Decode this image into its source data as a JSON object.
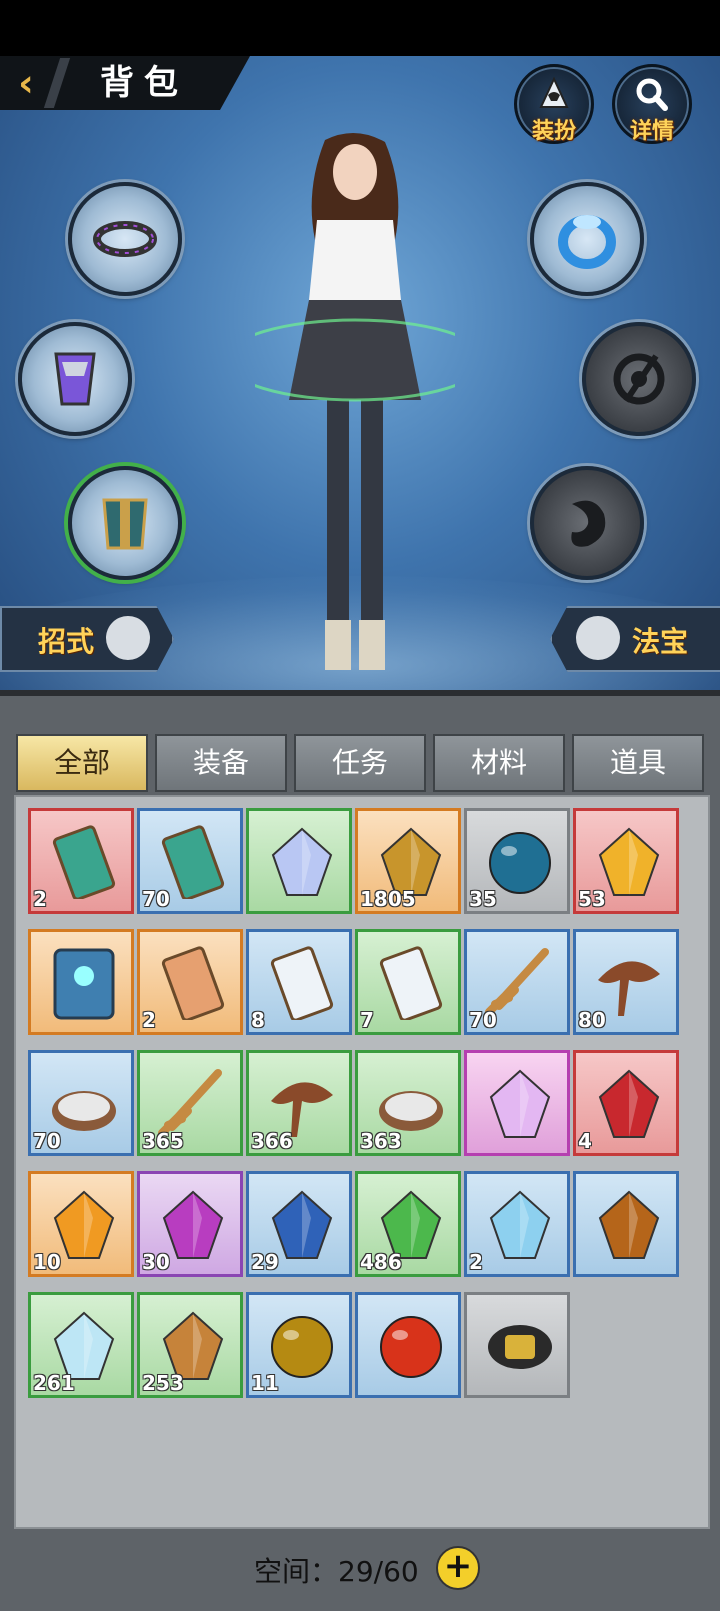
{
  "header": {
    "title": "背包",
    "back_icon": "‹"
  },
  "top_buttons": [
    {
      "label": "装扮",
      "icon": "hooded-figure-icon"
    },
    {
      "label": "详情",
      "icon": "magnifier-icon"
    }
  ],
  "side_buttons": {
    "left": "招式",
    "right": "法宝"
  },
  "tabs": [
    {
      "label": "全部",
      "active": true
    },
    {
      "label": "装备"
    },
    {
      "label": "任务"
    },
    {
      "label": "材料"
    },
    {
      "label": "道具"
    }
  ],
  "items": [
    {
      "quality": "red",
      "icon": "scroll-icon",
      "count": "2"
    },
    {
      "quality": "blue",
      "icon": "scroll-icon",
      "count": "70"
    },
    {
      "quality": "green",
      "icon": "crystal-icon",
      "count": ""
    },
    {
      "quality": "orange",
      "icon": "gold-egg-icon",
      "count": "1805"
    },
    {
      "quality": "grey",
      "icon": "blue-orb-icon",
      "count": "35"
    },
    {
      "quality": "red",
      "icon": "gold-drop-icon",
      "count": "53"
    },
    {
      "quality": "orange",
      "icon": "meditation-tablet-icon",
      "count": ""
    },
    {
      "quality": "orange",
      "icon": "talisman-icon",
      "count": "2"
    },
    {
      "quality": "blue",
      "icon": "paper-charm-icon",
      "count": "8"
    },
    {
      "quality": "green",
      "icon": "paper-charm-icon",
      "count": "7"
    },
    {
      "quality": "blue",
      "icon": "ginseng-icon",
      "count": "70"
    },
    {
      "quality": "blue",
      "icon": "lingzhi-icon",
      "count": "80"
    },
    {
      "quality": "blue",
      "icon": "rice-bowl-icon",
      "count": "70"
    },
    {
      "quality": "green",
      "icon": "ginseng-icon",
      "count": "365"
    },
    {
      "quality": "green",
      "icon": "lingzhi-icon",
      "count": "366"
    },
    {
      "quality": "green",
      "icon": "rice-bowl-icon",
      "count": "363"
    },
    {
      "quality": "pink",
      "icon": "rainbow-gem-icon",
      "count": ""
    },
    {
      "quality": "red",
      "icon": "red-ore-icon",
      "count": "4"
    },
    {
      "quality": "orange",
      "icon": "amber-gem-icon",
      "count": "10"
    },
    {
      "quality": "purple",
      "icon": "purple-gem-icon",
      "count": "30"
    },
    {
      "quality": "blue",
      "icon": "blue-gem-icon",
      "count": "29"
    },
    {
      "quality": "green",
      "icon": "green-shard-icon",
      "count": "486"
    },
    {
      "quality": "blue",
      "icon": "ice-stone-icon",
      "count": "2"
    },
    {
      "quality": "blue",
      "icon": "fire-stone-icon",
      "count": ""
    },
    {
      "quality": "green",
      "icon": "ice-crystal-icon",
      "count": "261"
    },
    {
      "quality": "green",
      "icon": "fire-egg-icon",
      "count": "253"
    },
    {
      "quality": "blue",
      "icon": "gold-orb-icon",
      "count": "11"
    },
    {
      "quality": "blue",
      "icon": "red-orb-icon",
      "count": ""
    },
    {
      "quality": "grey",
      "icon": "belt-icon",
      "count": ""
    }
  ],
  "footer": {
    "space_label": "空间：29/60",
    "plus_icon": "+"
  }
}
